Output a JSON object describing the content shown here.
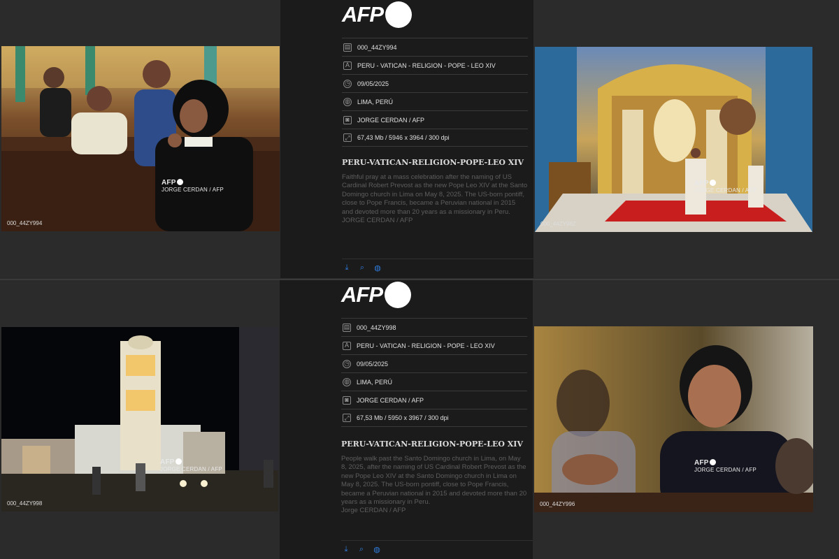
{
  "agency_logo": "AFP",
  "photos": [
    {
      "id": "000_44ZY994",
      "credit_mark": "AFP",
      "credit": "JORGE CERDAN / AFP",
      "scene": "nun-praying-pews"
    },
    {
      "id": "000_44ZY98Z",
      "credit_mark": "AFP",
      "credit": "JORGE CERDAN / AFP",
      "scene": "church-altar-mass"
    },
    {
      "id": "000_44ZY998",
      "credit_mark": "AFP",
      "credit": "JORGE CERDAN / AFP",
      "scene": "santo-domingo-night"
    },
    {
      "id": "000_44ZY996",
      "credit_mark": "AFP",
      "credit": "JORGE CERDAN / AFP",
      "scene": "woman-praying"
    }
  ],
  "panels": [
    {
      "id": "000_44ZY994",
      "title": "PERU - VATICAN - RELIGION - POPE - LEO XIV",
      "date": "09/05/2025",
      "location": "LIMA, PERÚ",
      "photographer": "JORGE CERDAN / AFP",
      "file_info": "67,43 Mb / 5946 x 3964 / 300 dpi",
      "headline": "PERU-VATICAN-RELIGION-POPE-LEO XIV",
      "caption": "Faithful pray at a mass celebration after the naming of US Cardinal Robert Prevost as the new Pope Leo XIV at the Santo Domingo church in Lima on May 8, 2025. The US-born pontiff, close to Pope Francis, became a Peruvian national in 2015 and devoted more than 20 years as a missionary in Peru.",
      "byline": "JORGE CERDAN / AFP"
    },
    {
      "id": "000_44ZY998",
      "title": "PERU - VATICAN - RELIGION - POPE - LEO XIV",
      "date": "09/05/2025",
      "location": "LIMA, PERÚ",
      "photographer": "JORGE CERDAN / AFP",
      "file_info": "67,53 Mb / 5950 x 3967 / 300 dpi",
      "headline": "PERU-VATICAN-RELIGION-POPE-LEO XIV",
      "caption": "People walk past the Santo Domingo church in Lima, on May 8, 2025, after the naming of US Cardinal Robert Prevost as the new Pope Leo XIV at the Santo Domingo church in Lima on May 8, 2025. The US-born pontiff, close to Pope Francis, became a Peruvian national in 2015 and devoted more than 20 years as a missionary in Peru.",
      "byline": "Jorge CERDAN / AFP"
    }
  ],
  "actions": [
    {
      "name": "download-icon",
      "glyph": "⤓"
    },
    {
      "name": "zoom-icon",
      "glyph": "⌕"
    },
    {
      "name": "globe-icon",
      "glyph": "◍"
    }
  ],
  "row_icons": [
    {
      "name": "file-icon",
      "glyph": "▤"
    },
    {
      "name": "title-icon",
      "glyph": "A"
    },
    {
      "name": "clock-icon",
      "glyph": "◷"
    },
    {
      "name": "location-globe-icon",
      "glyph": "◍"
    },
    {
      "name": "camera-icon",
      "glyph": "◙"
    },
    {
      "name": "size-icon",
      "glyph": "⤢"
    }
  ]
}
